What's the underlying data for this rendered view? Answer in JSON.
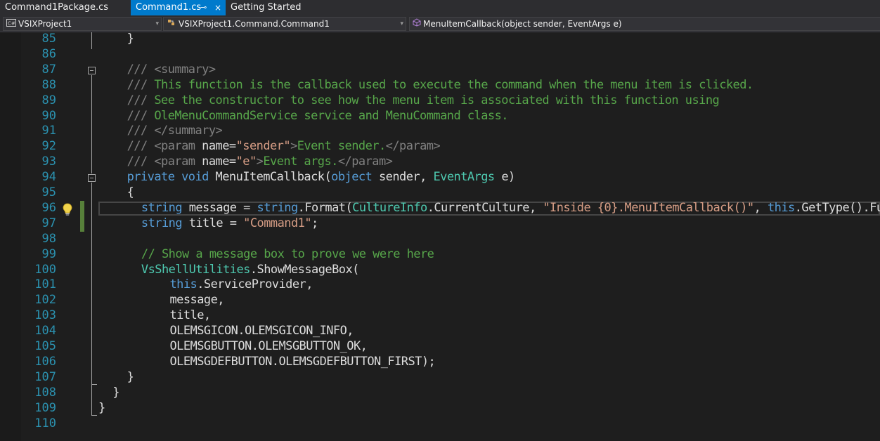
{
  "tabs": [
    {
      "label": "Command1Package.cs",
      "active": false
    },
    {
      "label": "Command1.cs",
      "active": true
    },
    {
      "label": "Getting Started",
      "active": false
    }
  ],
  "tab_pin_glyph": "⊸",
  "tab_close_glyph": "×",
  "navbar": {
    "project": "VSIXProject1",
    "class": "VSIXProject1.Command.Command1",
    "member": "MenuItemCallback(object sender, EventArgs e)"
  },
  "colors": {
    "accent": "#007acc",
    "line_number": "#2b91af",
    "comment": "#57a64a",
    "keyword": "#569cd6",
    "type": "#4ec9b0",
    "string": "#d69d85",
    "change_bar": "#57803a"
  },
  "icons": {
    "project": "csharp-project-icon",
    "class": "class-icon",
    "member": "method-icon",
    "lightbulb": "lightbulb-icon"
  },
  "editor": {
    "line_numbers": [
      "85",
      "86",
      "87",
      "88",
      "89",
      "90",
      "91",
      "92",
      "93",
      "94",
      "95",
      "96",
      "97",
      "98",
      "99",
      "100",
      "101",
      "102",
      "103",
      "104",
      "105",
      "106",
      "107",
      "108",
      "109",
      "110"
    ],
    "lines": [
      {
        "n": "85",
        "indent": 2,
        "tokens": [
          {
            "t": "}",
            "c": "plain"
          }
        ]
      },
      {
        "n": "86",
        "indent": 0,
        "tokens": []
      },
      {
        "n": "87",
        "indent": 2,
        "tokens": [
          {
            "t": "/// ",
            "c": "xmltag"
          },
          {
            "t": "<summary>",
            "c": "xmltag"
          }
        ]
      },
      {
        "n": "88",
        "indent": 2,
        "tokens": [
          {
            "t": "/// ",
            "c": "xmltag"
          },
          {
            "t": "This function is the callback used to execute the command when the menu item is clicked.",
            "c": "comment"
          }
        ]
      },
      {
        "n": "89",
        "indent": 2,
        "tokens": [
          {
            "t": "/// ",
            "c": "xmltag"
          },
          {
            "t": "See the constructor to see how the menu item is associated with this function using",
            "c": "comment"
          }
        ]
      },
      {
        "n": "90",
        "indent": 2,
        "tokens": [
          {
            "t": "/// ",
            "c": "xmltag"
          },
          {
            "t": "OleMenuCommandService service and MenuCommand class.",
            "c": "comment"
          }
        ]
      },
      {
        "n": "91",
        "indent": 2,
        "tokens": [
          {
            "t": "/// ",
            "c": "xmltag"
          },
          {
            "t": "</summary>",
            "c": "xmltag"
          }
        ]
      },
      {
        "n": "92",
        "indent": 2,
        "tokens": [
          {
            "t": "/// ",
            "c": "xmltag"
          },
          {
            "t": "<param ",
            "c": "xmltag"
          },
          {
            "t": "name=",
            "c": "plain"
          },
          {
            "t": "\"sender\"",
            "c": "string"
          },
          {
            "t": ">",
            "c": "xmltag"
          },
          {
            "t": "Event sender.",
            "c": "comment"
          },
          {
            "t": "</param>",
            "c": "xmltag"
          }
        ]
      },
      {
        "n": "93",
        "indent": 2,
        "tokens": [
          {
            "t": "/// ",
            "c": "xmltag"
          },
          {
            "t": "<param ",
            "c": "xmltag"
          },
          {
            "t": "name=",
            "c": "plain"
          },
          {
            "t": "\"e\"",
            "c": "string"
          },
          {
            "t": ">",
            "c": "xmltag"
          },
          {
            "t": "Event args.",
            "c": "comment"
          },
          {
            "t": "</param>",
            "c": "xmltag"
          }
        ]
      },
      {
        "n": "94",
        "indent": 2,
        "tokens": [
          {
            "t": "private ",
            "c": "keyword"
          },
          {
            "t": "void ",
            "c": "keyword"
          },
          {
            "t": "MenuItemCallback(",
            "c": "plain"
          },
          {
            "t": "object ",
            "c": "keyword"
          },
          {
            "t": "sender, ",
            "c": "plain"
          },
          {
            "t": "EventArgs ",
            "c": "type"
          },
          {
            "t": "e)",
            "c": "plain"
          }
        ]
      },
      {
        "n": "95",
        "indent": 2,
        "tokens": [
          {
            "t": "{",
            "c": "plain"
          }
        ]
      },
      {
        "n": "96",
        "indent": 3,
        "tokens": [
          {
            "t": "string ",
            "c": "keyword"
          },
          {
            "t": "message = ",
            "c": "plain"
          },
          {
            "t": "string",
            "c": "keyword"
          },
          {
            "t": ".Format(",
            "c": "plain"
          },
          {
            "t": "CultureInfo",
            "c": "type"
          },
          {
            "t": ".CurrentCulture, ",
            "c": "plain"
          },
          {
            "t": "\"Inside {0}.MenuItemCallback()\"",
            "c": "string"
          },
          {
            "t": ", ",
            "c": "plain"
          },
          {
            "t": "this",
            "c": "keyword"
          },
          {
            "t": ".GetType().FullName);",
            "c": "plain"
          }
        ]
      },
      {
        "n": "97",
        "indent": 3,
        "tokens": [
          {
            "t": "string ",
            "c": "keyword"
          },
          {
            "t": "title = ",
            "c": "plain"
          },
          {
            "t": "\"Command1\"",
            "c": "string"
          },
          {
            "t": ";",
            "c": "plain"
          }
        ]
      },
      {
        "n": "98",
        "indent": 0,
        "tokens": []
      },
      {
        "n": "99",
        "indent": 3,
        "tokens": [
          {
            "t": "// Show a message box to prove we were here",
            "c": "comment"
          }
        ]
      },
      {
        "n": "100",
        "indent": 3,
        "tokens": [
          {
            "t": "VsShellUtilities",
            "c": "type"
          },
          {
            "t": ".ShowMessageBox(",
            "c": "plain"
          }
        ]
      },
      {
        "n": "101",
        "indent": 5,
        "tokens": [
          {
            "t": "this",
            "c": "keyword"
          },
          {
            "t": ".ServiceProvider,",
            "c": "plain"
          }
        ]
      },
      {
        "n": "102",
        "indent": 5,
        "tokens": [
          {
            "t": "message,",
            "c": "plain"
          }
        ]
      },
      {
        "n": "103",
        "indent": 5,
        "tokens": [
          {
            "t": "title,",
            "c": "plain"
          }
        ]
      },
      {
        "n": "104",
        "indent": 5,
        "tokens": [
          {
            "t": "OLEMSGICON.OLEMSGICON_INFO,",
            "c": "plain"
          }
        ]
      },
      {
        "n": "105",
        "indent": 5,
        "tokens": [
          {
            "t": "OLEMSGBUTTON.OLEMSGBUTTON_OK,",
            "c": "plain"
          }
        ]
      },
      {
        "n": "106",
        "indent": 5,
        "tokens": [
          {
            "t": "OLEMSGDEFBUTTON.OLEMSGDEFBUTTON_FIRST);",
            "c": "plain"
          }
        ]
      },
      {
        "n": "107",
        "indent": 2,
        "tokens": [
          {
            "t": "}",
            "c": "plain"
          }
        ]
      },
      {
        "n": "108",
        "indent": 1,
        "tokens": [
          {
            "t": "}",
            "c": "plain"
          }
        ]
      },
      {
        "n": "109",
        "indent": 0,
        "tokens": [
          {
            "t": "}",
            "c": "plain"
          }
        ]
      },
      {
        "n": "110",
        "indent": 0,
        "tokens": []
      }
    ]
  }
}
